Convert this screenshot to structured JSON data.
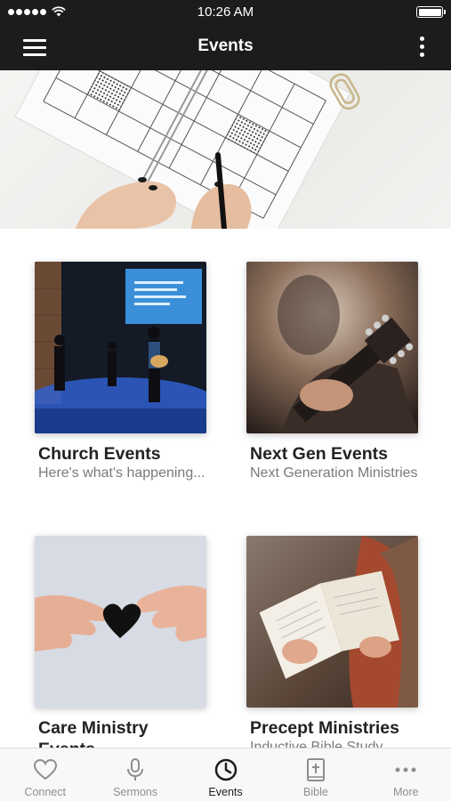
{
  "status_bar": {
    "time": "10:26 AM"
  },
  "nav": {
    "title": "Events"
  },
  "cards": [
    {
      "title": "Church Events",
      "subtitle": "Here's what's happening..."
    },
    {
      "title": "Next Gen Events",
      "subtitle": "Next Generation Ministries"
    },
    {
      "title": "Care Ministry Events",
      "subtitle": ""
    },
    {
      "title": "Precept Ministries",
      "subtitle": "Inductive Bible Study"
    }
  ],
  "tabs": [
    {
      "label": "Connect",
      "icon": "heart-icon"
    },
    {
      "label": "Sermons",
      "icon": "microphone-icon"
    },
    {
      "label": "Events",
      "icon": "clock-icon",
      "active": true
    },
    {
      "label": "Bible",
      "icon": "bible-icon"
    },
    {
      "label": "More",
      "icon": "more-dots-icon"
    }
  ],
  "colors": {
    "bar": "#1c1c1c",
    "active_tab": "#1c1c1c",
    "inactive_tab": "#8e8e8e"
  }
}
